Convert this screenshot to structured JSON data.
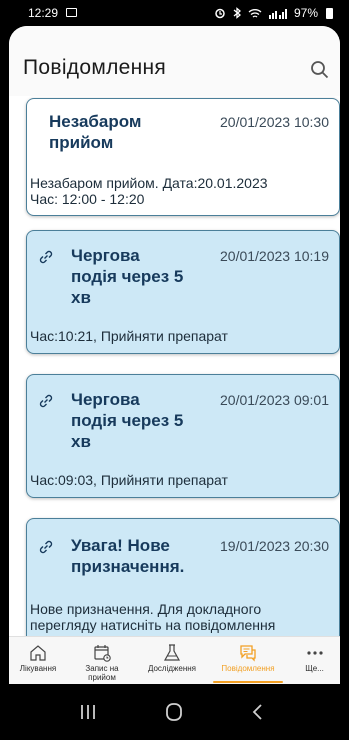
{
  "status_bar": {
    "time": "12:29",
    "battery": "97%"
  },
  "header": {
    "title": "Повідомлення"
  },
  "notifications": [
    {
      "title_lines": [
        "Незабаром",
        "прийом"
      ],
      "date": "20/01/2023 10:30",
      "body_lines": [
        "Незабаром прийом. Дата:20.01.2023",
        "Час: 12:00 - 12:20"
      ],
      "has_icon": false
    },
    {
      "title_lines": [
        "Чергова",
        "подія через 5",
        "хв"
      ],
      "date": "20/01/2023 10:19",
      "body_lines": [
        "Час:10:21, Прийняти препарат"
      ],
      "has_icon": true
    },
    {
      "title_lines": [
        "Чергова",
        "подія через 5",
        "хв"
      ],
      "date": "20/01/2023 09:01",
      "body_lines": [
        "Час:09:03, Прийняти препарат"
      ],
      "has_icon": true
    },
    {
      "title_lines": [
        "Увага! Нове",
        "призначення."
      ],
      "date": "19/01/2023 20:30",
      "body_lines": [
        "Нове призначення. Для докладного",
        "перегляду натисніть на повідомлення"
      ],
      "has_icon": true
    }
  ],
  "bottom_nav": {
    "items": [
      {
        "label": "Лікування",
        "icon": "home-icon"
      },
      {
        "label": "Запис на прийом",
        "icon": "calendar-clock-icon"
      },
      {
        "label": "Дослідження",
        "icon": "flask-icon"
      },
      {
        "label": "Повідомлення",
        "icon": "chat-icon",
        "active": true
      },
      {
        "label": "Ще...",
        "icon": "more-icon"
      }
    ]
  },
  "colors": {
    "accent": "#f2a024",
    "unread_bg": "#cde8f6",
    "card_border": "#4b7f99",
    "title": "#173a5c"
  }
}
